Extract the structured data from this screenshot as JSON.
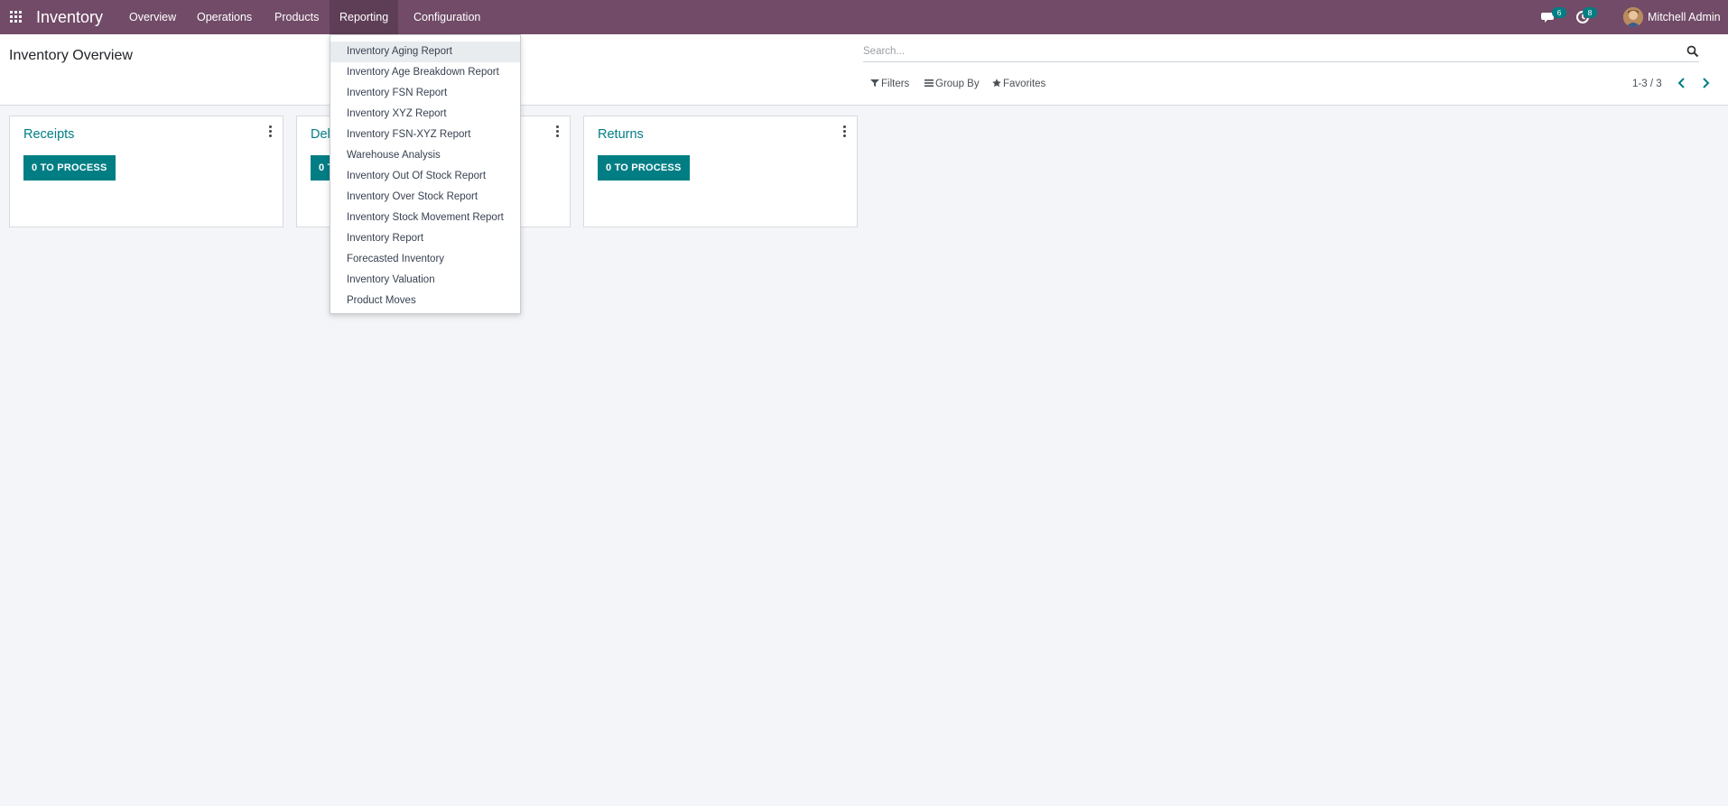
{
  "navbar": {
    "brand": "Inventory",
    "menus": [
      "Overview",
      "Operations",
      "Products",
      "Reporting",
      "Configuration"
    ],
    "active_menu": "Reporting",
    "messages_count": "6",
    "activities_count": "8",
    "user_name": "Mitchell Admin",
    "background_color": "#714b67"
  },
  "control_panel": {
    "title": "Inventory Overview",
    "search_placeholder": "Search...",
    "filters_label": "Filters",
    "group_by_label": "Group By",
    "favorites_label": "Favorites",
    "pager_value": "1-3 / 3"
  },
  "cards": [
    {
      "title": "Receipts",
      "button_label": "0 TO PROCESS"
    },
    {
      "title": "Delivery Orders",
      "button_label": "0 TO PROCESS"
    },
    {
      "title": "Returns",
      "button_label": "0 TO PROCESS"
    }
  ],
  "reporting_menu": {
    "items": [
      "Inventory Aging Report",
      "Inventory Age Breakdown Report",
      "Inventory FSN Report",
      "Inventory XYZ Report",
      "Inventory FSN-XYZ Report",
      "Warehouse Analysis",
      "Inventory Out Of Stock Report",
      "Inventory Over Stock Report",
      "Inventory Stock Movement Report",
      "Inventory Report",
      "Forecasted Inventory",
      "Inventory Valuation",
      "Product Moves"
    ],
    "highlighted_item": "Inventory Aging Report"
  },
  "colors": {
    "accent": "#017e84",
    "navbar": "#714b67",
    "page_background": "#f4f5f8"
  },
  "icons": {
    "apps": "apps-grid-icon",
    "messages": "chat-bubble-icon",
    "activities": "clock-icon",
    "search": "search-icon",
    "filter": "funnel-icon",
    "group_by": "list-icon",
    "favorites": "star-icon",
    "card_menu": "vertical-ellipsis-icon",
    "pager_prev": "chevron-left-icon",
    "pager_next": "chevron-right-icon"
  }
}
